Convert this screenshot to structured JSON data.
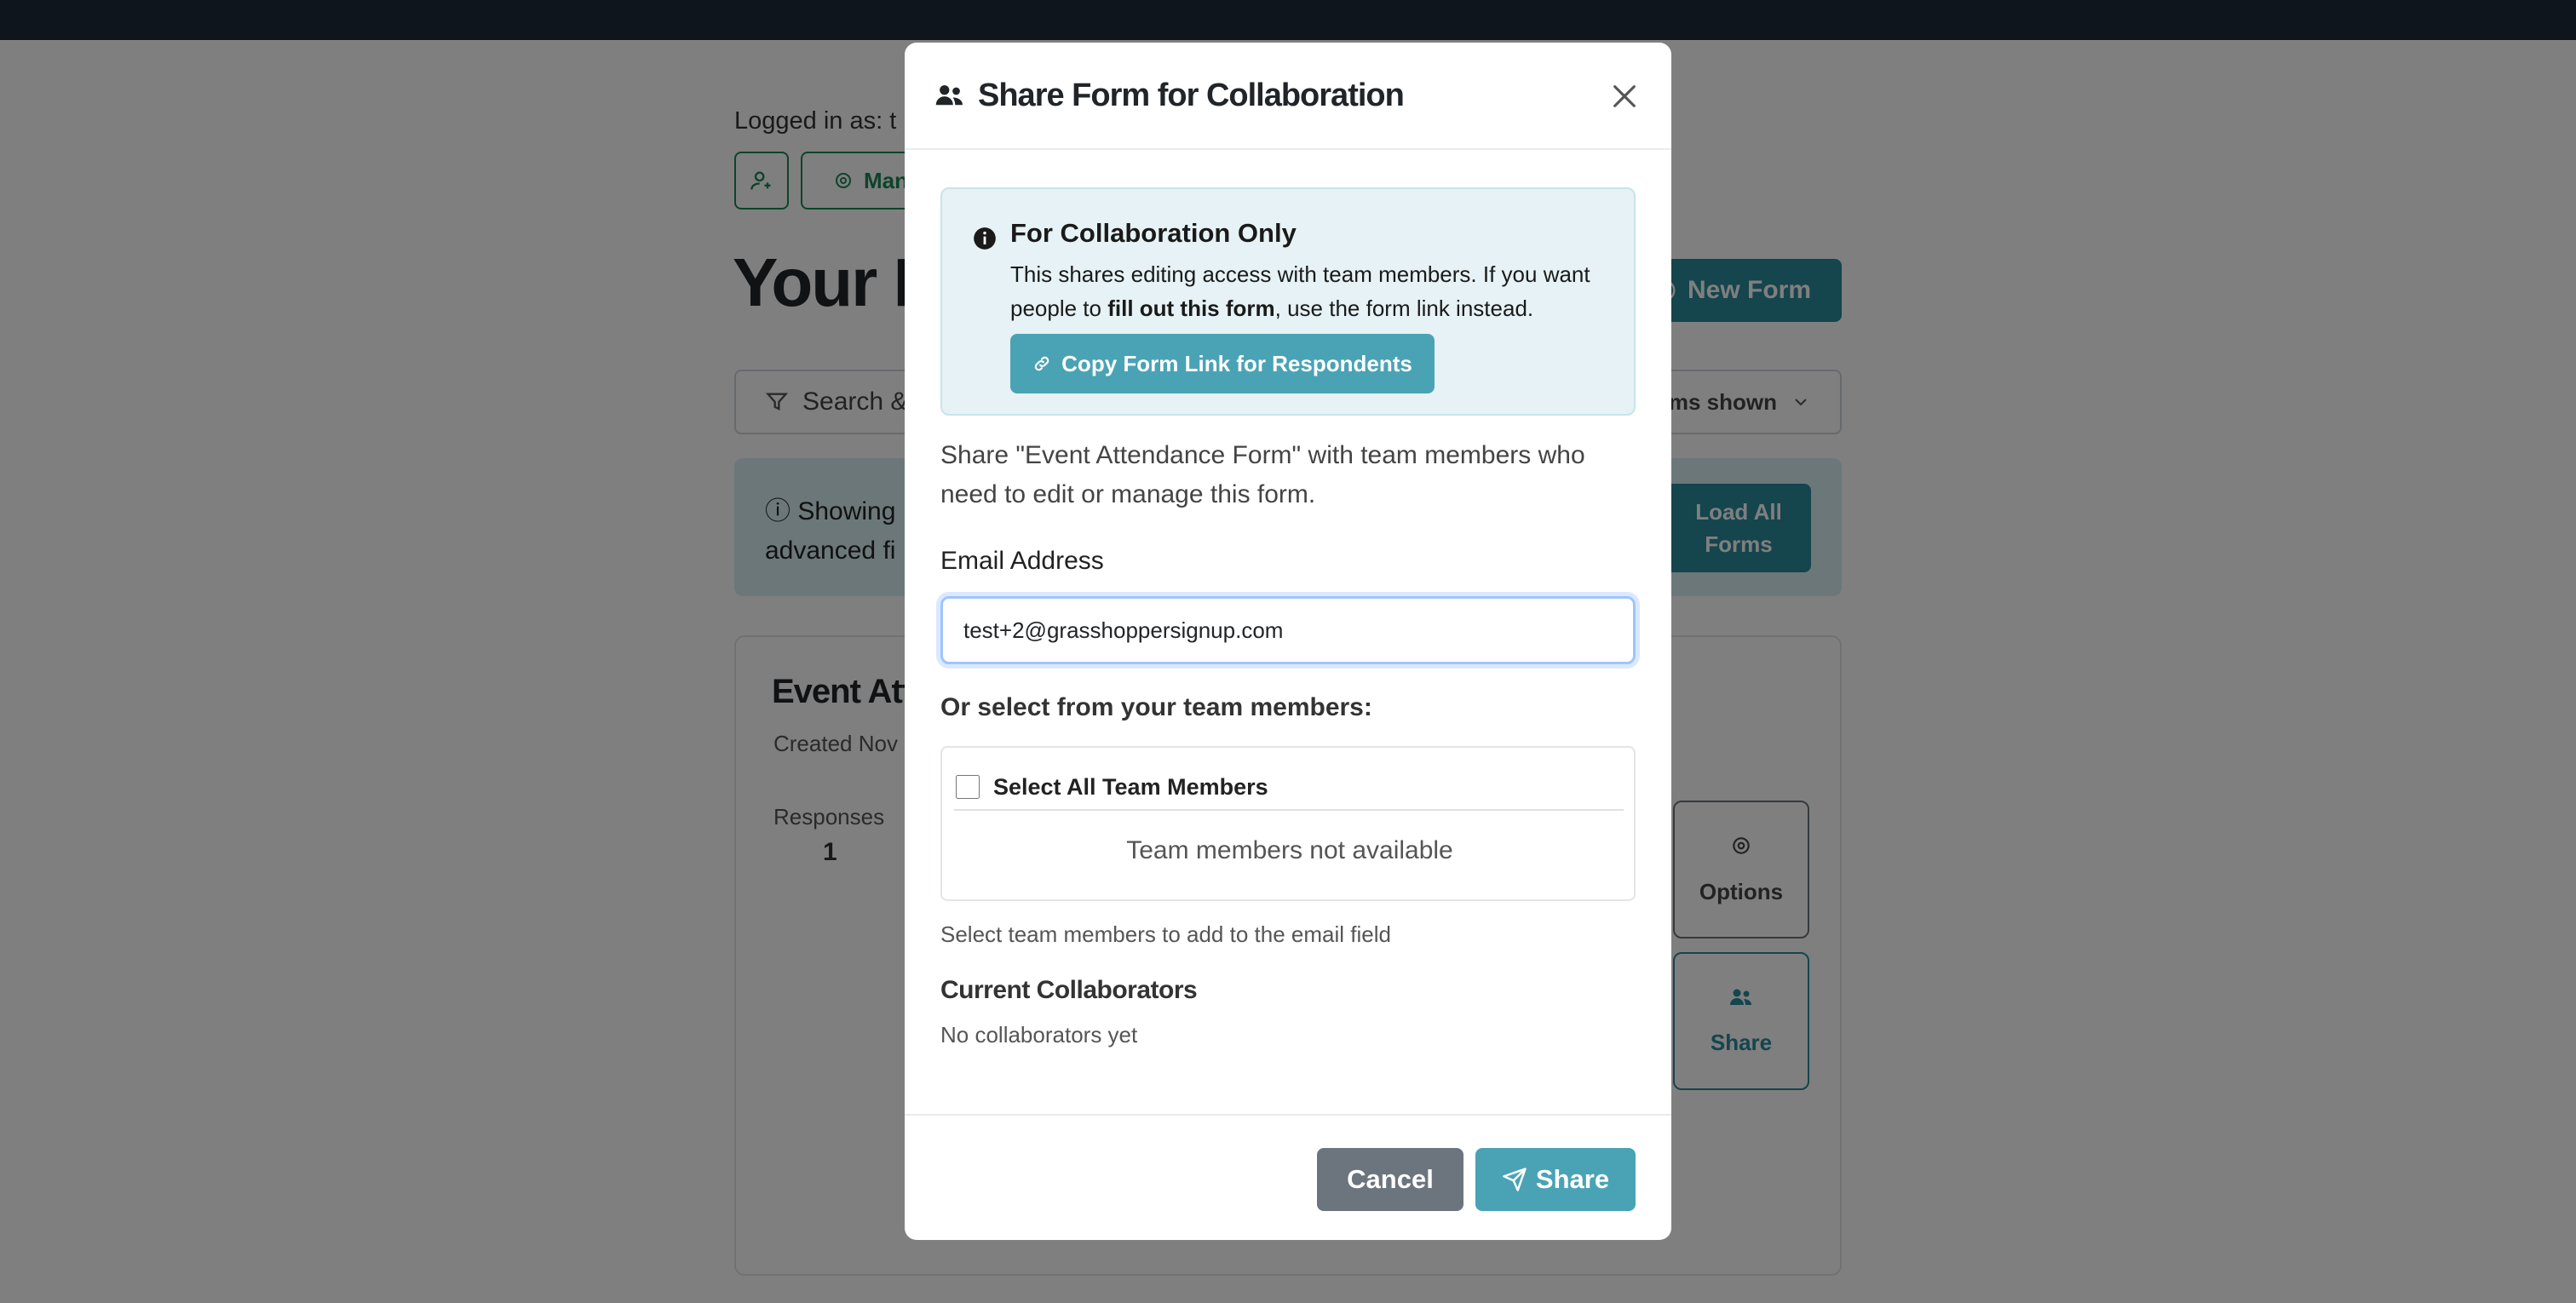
{
  "background": {
    "logged_in_label": "Logged in as: t",
    "manage_label": "Man",
    "page_title": "Your F",
    "new_form_label": "New Form",
    "filter": {
      "label": "Search &",
      "forms_shown": "rms shown"
    },
    "info_banner": {
      "text_line1": "Showing",
      "text_line2": "advanced fi",
      "load_all_label": "Load All Forms"
    },
    "form_card": {
      "title": "Event Atte",
      "created": "Created Nov",
      "responses_label": "Responses",
      "responses_value": "1",
      "options_label": "Options",
      "share_label": "Share"
    }
  },
  "modal": {
    "title": "Share Form for Collaboration",
    "alert": {
      "heading": "For Collaboration Only",
      "body_before": "This shares editing access with team members. If you want people to ",
      "body_bold": "fill out this form",
      "body_after": ", use the form link instead.",
      "copy_button": "Copy Form Link for Respondents"
    },
    "description": "Share \"Event Attendance Form\" with team members who need to edit or manage this form.",
    "email": {
      "label": "Email Address",
      "value": "test+2@grasshoppersignup.com"
    },
    "team": {
      "heading": "Or select from your team members:",
      "select_all_label": "Select All Team Members",
      "select_all_checked": false,
      "unavailable_text": "Team members not available",
      "help_text": "Select team members to add to the email field"
    },
    "collaborators": {
      "heading": "Current Collaborators",
      "empty_text": "No collaborators yet"
    },
    "footer": {
      "cancel_label": "Cancel",
      "share_label": "Share"
    }
  },
  "colors": {
    "topbar": "#1e2a3a",
    "accent": "#4aa3b5",
    "secondary": "#6c757d",
    "success": "#198754"
  },
  "icons": [
    "users-icon",
    "close-icon",
    "info-icon",
    "link-icon",
    "send-icon",
    "filter-icon",
    "chevron-down-icon",
    "gear-icon",
    "user-plus-icon",
    "plus-circle-icon"
  ]
}
